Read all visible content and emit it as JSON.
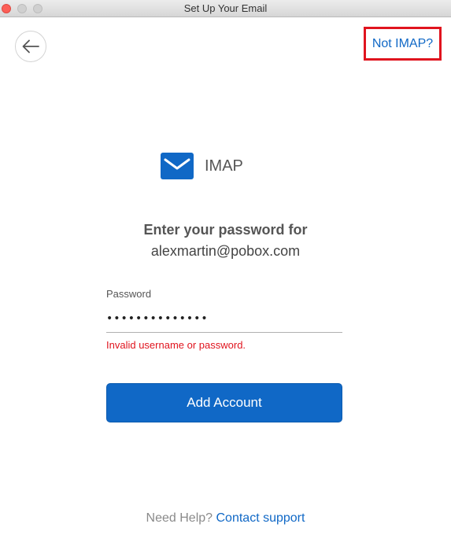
{
  "window": {
    "title": "Set Up Your Email"
  },
  "header": {
    "back_icon": "arrow-left-icon",
    "not_imap_label": "Not IMAP?"
  },
  "provider": {
    "icon": "envelope-icon",
    "label": "IMAP",
    "accent": "#1068c6"
  },
  "prompt": {
    "heading": "Enter your password for",
    "email": "alexmartin@pobox.com"
  },
  "password": {
    "label": "Password",
    "value": "••••••••••••••"
  },
  "error": {
    "message": "Invalid username or password.",
    "color": "#e0141e"
  },
  "actions": {
    "add_account_label": "Add Account"
  },
  "help": {
    "text": "Need Help?",
    "link_label": "Contact support"
  }
}
